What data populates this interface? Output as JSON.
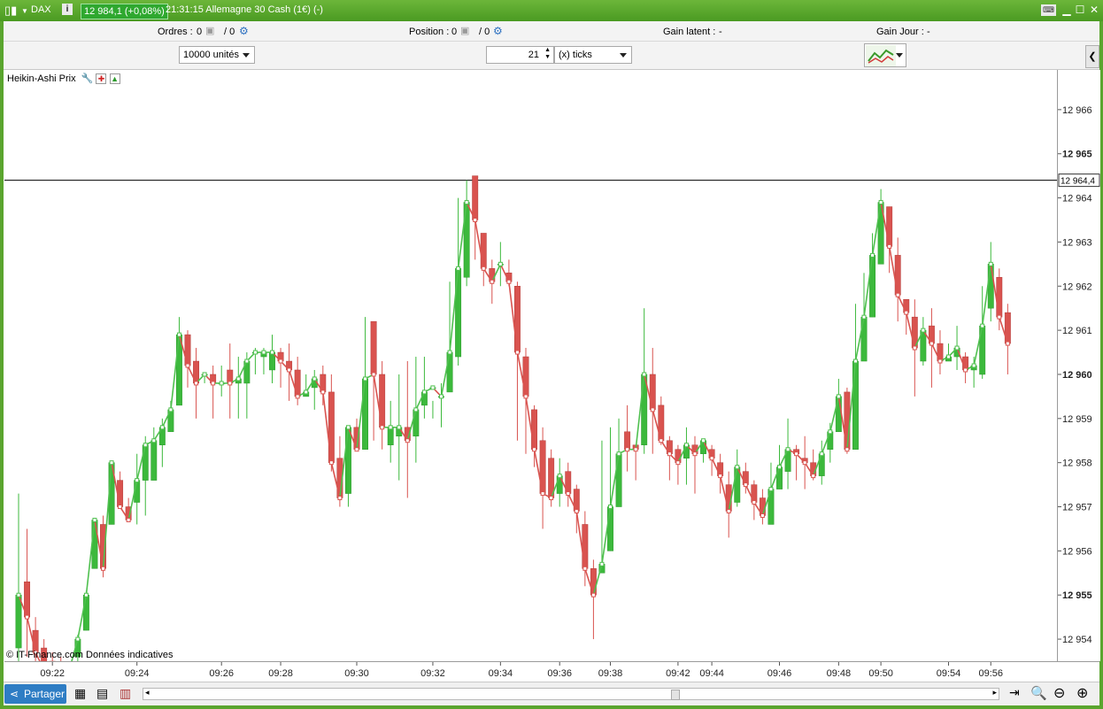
{
  "titlebar": {
    "instrument": "DAX",
    "price_badge": "12 984,1 (+0,08%)",
    "time_title": "21:31:15 Allemagne 30 Cash (1€) (-)"
  },
  "toolbar": {
    "orders_label": "Ordres :",
    "orders_value": "0",
    "orders_value2": "/ 0",
    "position_label": "Position :",
    "position_value": "0",
    "position_value2": "/ 0",
    "gain_latent_label": "Gain latent :",
    "gain_latent_value": "-",
    "gain_jour_label": "Gain Jour :",
    "gain_jour_value": "-"
  },
  "controls": {
    "quantity_select": "10000 unités",
    "ticks_value": "21",
    "ticks_unit_select": "(x) ticks"
  },
  "indicator": {
    "label": "Heikin-Ashi Prix"
  },
  "copyright": "© IT-Finance.com Données indicatives",
  "bottom": {
    "share_label": "Partager"
  },
  "colors": {
    "up": "#3cb93c",
    "down": "#d9534f",
    "up_line": "#4fc04f",
    "down_line": "#d9534f"
  },
  "chart_data": {
    "type": "candlestick",
    "ylim": [
      12953.5,
      12966.9
    ],
    "yticks": [
      {
        "value": 12966,
        "label": "12 966"
      },
      {
        "value": 12965,
        "label": "12 965",
        "bold": true
      },
      {
        "value": 12964,
        "label": "12 964"
      },
      {
        "value": 12963,
        "label": "12 963"
      },
      {
        "value": 12962,
        "label": "12 962"
      },
      {
        "value": 12961,
        "label": "12 961"
      },
      {
        "value": 12960,
        "label": "12 960",
        "bold": true
      },
      {
        "value": 12959,
        "label": "12 959"
      },
      {
        "value": 12958,
        "label": "12 958"
      },
      {
        "value": 12957,
        "label": "12 957"
      },
      {
        "value": 12956,
        "label": "12 956"
      },
      {
        "value": 12955,
        "label": "12 955",
        "bold": true
      },
      {
        "value": 12954,
        "label": "12 954"
      }
    ],
    "current_price": {
      "value": 12964.4,
      "label": "12 964,4"
    },
    "xticks": [
      "09:22",
      "09:24",
      "09:26",
      "09:28",
      "09:30",
      "09:32",
      "09:34",
      "09:36",
      "09:38",
      "09:42",
      "09:44",
      "09:46",
      "09:48",
      "09:50",
      "09:54",
      "09:56"
    ],
    "xtick_index": [
      4,
      14,
      24,
      31,
      40,
      49,
      57,
      64,
      70,
      78,
      82,
      90,
      97,
      102,
      110,
      115
    ],
    "candles": [
      [
        12953.8,
        12955.0,
        12953.4,
        12957.3
      ],
      [
        12955.3,
        12954.5,
        12953.6,
        12956.5
      ],
      [
        12954.2,
        12953.7,
        12953.4,
        12954.5
      ],
      [
        12953.8,
        12953.3,
        12953.0,
        12954.0
      ],
      [
        12953.5,
        12953.2,
        12953.0,
        12953.7
      ],
      [
        12953.4,
        12953.1,
        12952.9,
        12953.6
      ],
      [
        12953.0,
        12953.3,
        12953.0,
        12953.3
      ],
      [
        12953.6,
        12954.0,
        12953.5,
        12954.1
      ],
      [
        12954.2,
        12955.0,
        12954.2,
        12955.1
      ],
      [
        12955.6,
        12956.7,
        12955.6,
        12956.7
      ],
      [
        12956.6,
        12955.6,
        12955.4,
        12956.8
      ],
      [
        12956.6,
        12958.0,
        12956.6,
        12958.0
      ],
      [
        12957.6,
        12957.0,
        12957.0,
        12957.8
      ],
      [
        12957.0,
        12956.7,
        12956.7,
        12957.2
      ],
      [
        12957.1,
        12957.6,
        12956.6,
        12958.2
      ],
      [
        12957.6,
        12958.4,
        12956.8,
        12958.6
      ],
      [
        12957.6,
        12958.5,
        12957.6,
        12958.8
      ],
      [
        12958.4,
        12958.8,
        12957.9,
        12959.0
      ],
      [
        12958.7,
        12959.2,
        12958.7,
        12959.4
      ],
      [
        12959.3,
        12960.9,
        12959.3,
        12961.3
      ],
      [
        12960.9,
        12960.2,
        12959.7,
        12961.0
      ],
      [
        12960.3,
        12959.8,
        12959.0,
        12960.6
      ],
      [
        12960.0,
        12960.0,
        12959.8,
        12960.0
      ],
      [
        12960.0,
        12959.8,
        12959.0,
        12960.2
      ],
      [
        12959.8,
        12959.8,
        12959.5,
        12960.2
      ],
      [
        12960.1,
        12959.8,
        12959.0,
        12960.7
      ],
      [
        12959.8,
        12959.9,
        12959.0,
        12960.4
      ],
      [
        12959.8,
        12960.3,
        12959.0,
        12960.5
      ],
      [
        12960.5,
        12960.5,
        12960.0,
        12960.6
      ],
      [
        12960.4,
        12960.5,
        12960.0,
        12960.6
      ],
      [
        12960.1,
        12960.5,
        12959.8,
        12960.9
      ],
      [
        12960.5,
        12960.3,
        12959.7,
        12960.6
      ],
      [
        12960.3,
        12960.1,
        12959.4,
        12960.7
      ],
      [
        12960.1,
        12959.5,
        12959.3,
        12960.4
      ],
      [
        12959.5,
        12959.6,
        12959.5,
        12960.0
      ],
      [
        12959.7,
        12959.9,
        12959.2,
        12960.1
      ],
      [
        12960.0,
        12959.6,
        12959.3,
        12960.2
      ],
      [
        12959.6,
        12958.0,
        12957.8,
        12960.0
      ],
      [
        12958.1,
        12957.2,
        12957.0,
        12958.6
      ],
      [
        12957.3,
        12958.8,
        12957.0,
        12958.8
      ],
      [
        12958.8,
        12958.3,
        12958.3,
        12959.0
      ],
      [
        12958.3,
        12959.9,
        12958.3,
        12961.3
      ],
      [
        12961.2,
        12960.0,
        12958.5,
        12961.1
      ],
      [
        12960.0,
        12958.8,
        12958.3,
        12960.3
      ],
      [
        12958.4,
        12958.8,
        12958.0,
        12959.4
      ],
      [
        12958.6,
        12958.8,
        12957.6,
        12960.0
      ],
      [
        12958.8,
        12958.5,
        12957.2,
        12960.3
      ],
      [
        12958.6,
        12959.2,
        12958.0,
        12960.4
      ],
      [
        12959.3,
        12959.6,
        12959.0,
        12960.4
      ],
      [
        12959.7,
        12959.7,
        12959.0,
        12959.4
      ],
      [
        12959.5,
        12959.5,
        12958.8,
        12959.8
      ],
      [
        12959.6,
        12960.5,
        12959.6,
        12962.1
      ],
      [
        12960.4,
        12962.4,
        12960.2,
        12964.0
      ],
      [
        12962.2,
        12963.9,
        12962.0,
        12964.4
      ],
      [
        12964.5,
        12963.5,
        12962.6,
        12964.4
      ],
      [
        12963.2,
        12962.4,
        12962.0,
        12963.2
      ],
      [
        12962.4,
        12962.1,
        12961.6,
        12962.6
      ],
      [
        12962.5,
        12962.5,
        12962.0,
        12963.0
      ],
      [
        12962.3,
        12962.1,
        12962.0,
        12962.6
      ],
      [
        12962.0,
        12960.5,
        12958.5,
        12962.1
      ],
      [
        12960.4,
        12959.5,
        12958.2,
        12960.6
      ],
      [
        12959.2,
        12958.3,
        12957.9,
        12959.3
      ],
      [
        12958.5,
        12957.3,
        12956.5,
        12958.8
      ],
      [
        12958.1,
        12957.2,
        12957.0,
        12958.3
      ],
      [
        12957.3,
        12957.7,
        12957.0,
        12958.1
      ],
      [
        12957.8,
        12957.3,
        12957.0,
        12958.0
      ],
      [
        12957.4,
        12956.9,
        12956.4,
        12957.5
      ],
      [
        12956.6,
        12955.6,
        12955.2,
        12956.9
      ],
      [
        12955.6,
        12955.0,
        12954.0,
        12955.8
      ],
      [
        12955.5,
        12955.7,
        12955.5,
        12958.5
      ],
      [
        12956.0,
        12957.0,
        12956.0,
        12958.8
      ],
      [
        12957.0,
        12958.2,
        12957.0,
        12959.0
      ],
      [
        12958.7,
        12958.3,
        12957.8,
        12959.3
      ],
      [
        12958.4,
        12958.3,
        12957.6,
        12958.4
      ],
      [
        12958.4,
        12960.0,
        12958.2,
        12961.5
      ],
      [
        12960.0,
        12959.2,
        12958.2,
        12960.6
      ],
      [
        12959.3,
        12958.5,
        12958.4,
        12959.5
      ],
      [
        12958.5,
        12958.2,
        12957.6,
        12958.6
      ],
      [
        12958.3,
        12958.0,
        12957.5,
        12958.4
      ],
      [
        12958.1,
        12958.4,
        12957.5,
        12958.8
      ],
      [
        12958.4,
        12958.2,
        12957.3,
        12958.6
      ],
      [
        12958.2,
        12958.5,
        12958.0,
        12958.5
      ],
      [
        12958.3,
        12958.1,
        12957.7,
        12958.4
      ],
      [
        12958.0,
        12957.7,
        12957.3,
        12958.2
      ],
      [
        12957.5,
        12956.9,
        12956.3,
        12957.8
      ],
      [
        12957.1,
        12957.9,
        12957.0,
        12958.3
      ],
      [
        12957.8,
        12957.5,
        12957.3,
        12958.0
      ],
      [
        12957.5,
        12957.1,
        12956.7,
        12957.6
      ],
      [
        12957.2,
        12956.8,
        12956.6,
        12957.4
      ],
      [
        12956.6,
        12957.4,
        12956.6,
        12958.0
      ],
      [
        12957.4,
        12957.9,
        12957.4,
        12958.4
      ],
      [
        12957.8,
        12958.3,
        12957.4,
        12959.0
      ],
      [
        12958.3,
        12958.2,
        12957.6,
        12958.4
      ],
      [
        12958.1,
        12958.0,
        12957.4,
        12958.6
      ],
      [
        12958.0,
        12957.7,
        12957.6,
        12958.3
      ],
      [
        12957.7,
        12958.2,
        12957.5,
        12958.5
      ],
      [
        12958.3,
        12958.7,
        12958.0,
        12958.9
      ],
      [
        12958.7,
        12959.5,
        12958.7,
        12959.9
      ],
      [
        12959.6,
        12958.3,
        12958.2,
        12959.7
      ],
      [
        12958.3,
        12960.3,
        12958.3,
        12961.6
      ],
      [
        12960.3,
        12961.3,
        12960.3,
        12962.3
      ],
      [
        12961.3,
        12962.7,
        12961.3,
        12963.2
      ],
      [
        12962.5,
        12963.9,
        12962.5,
        12964.2
      ],
      [
        12963.8,
        12962.9,
        12962.3,
        12963.6
      ],
      [
        12962.7,
        12961.8,
        12961.2,
        12963.1
      ],
      [
        12961.7,
        12961.4,
        12960.9,
        12961.5
      ],
      [
        12961.3,
        12960.6,
        12959.5,
        12961.7
      ],
      [
        12960.3,
        12961.0,
        12960.2,
        12961.3
      ],
      [
        12961.1,
        12960.7,
        12959.7,
        12961.5
      ],
      [
        12960.7,
        12960.3,
        12960.0,
        12961.0
      ],
      [
        12960.3,
        12960.4,
        12960.3,
        12960.7
      ],
      [
        12960.4,
        12960.6,
        12960.1,
        12961.1
      ],
      [
        12960.4,
        12960.1,
        12959.8,
        12960.5
      ],
      [
        12960.1,
        12960.2,
        12959.7,
        12960.4
      ],
      [
        12960.0,
        12961.1,
        12959.9,
        12962.0
      ],
      [
        12961.5,
        12962.5,
        12961.2,
        12963.0
      ],
      [
        12962.2,
        12961.3,
        12961.0,
        12962.4
      ],
      [
        12961.4,
        12960.7,
        12960.0,
        12961.6
      ]
    ]
  }
}
